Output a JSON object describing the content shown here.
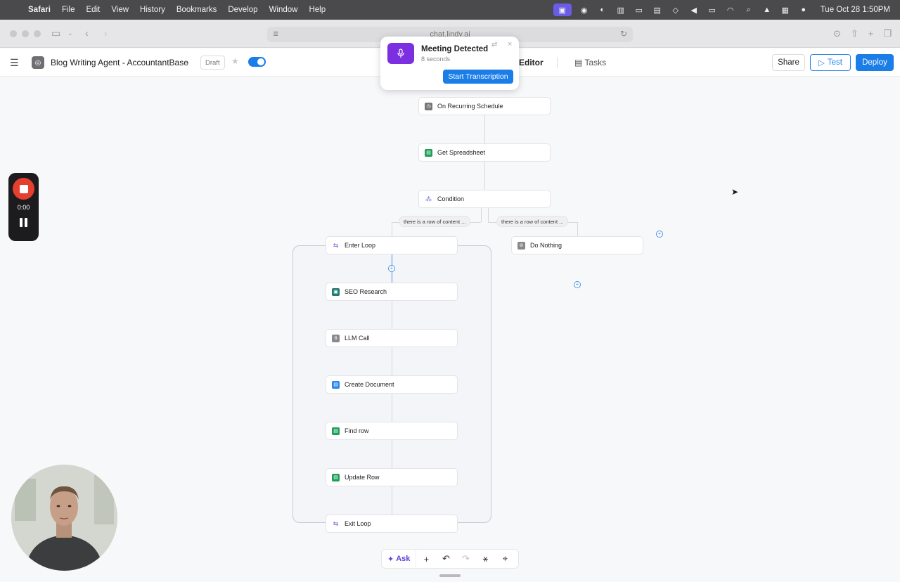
{
  "menubar": {
    "items": [
      "Safari",
      "File",
      "Edit",
      "View",
      "History",
      "Bookmarks",
      "Develop",
      "Window",
      "Help"
    ],
    "clock": "Tue Oct 28  1:50PM"
  },
  "browser": {
    "url": "chat.lindy.ai"
  },
  "header": {
    "agent_title": "Blog Writing Agent - AccountantBase",
    "draft_label": "Draft",
    "tab_editor": "Editor",
    "tab_tasks": "Tasks",
    "share_label": "Share",
    "test_label": "Test",
    "deploy_label": "Deploy",
    "accent_color": "#1a7de8"
  },
  "notification": {
    "title": "Meeting Detected",
    "subtitle": "8 seconds",
    "button_label": "Start Transcription"
  },
  "workflow": {
    "nodes": [
      {
        "label": "On Recurring Schedule",
        "icon": "schedule-icon"
      },
      {
        "label": "Get Spreadsheet",
        "icon": "sheets-icon"
      },
      {
        "label": "Condition",
        "icon": "condition-icon"
      },
      {
        "label": "Enter Loop",
        "icon": "loop-icon"
      },
      {
        "label": "Do Nothing",
        "icon": "nothing-icon"
      },
      {
        "label": "SEO Research",
        "icon": "seo-icon"
      },
      {
        "label": "LLM Call",
        "icon": "llm-icon"
      },
      {
        "label": "Create Document",
        "icon": "docs-icon"
      },
      {
        "label": "Find row",
        "icon": "sheets-icon"
      },
      {
        "label": "Update Row",
        "icon": "sheets-icon"
      },
      {
        "label": "Exit Loop",
        "icon": "loop-icon"
      }
    ],
    "branches": [
      "there is a row of content ...",
      "there is a row of content ..."
    ]
  },
  "recorder": {
    "time": "0:00"
  },
  "toolbar": {
    "ask_label": "Ask"
  }
}
